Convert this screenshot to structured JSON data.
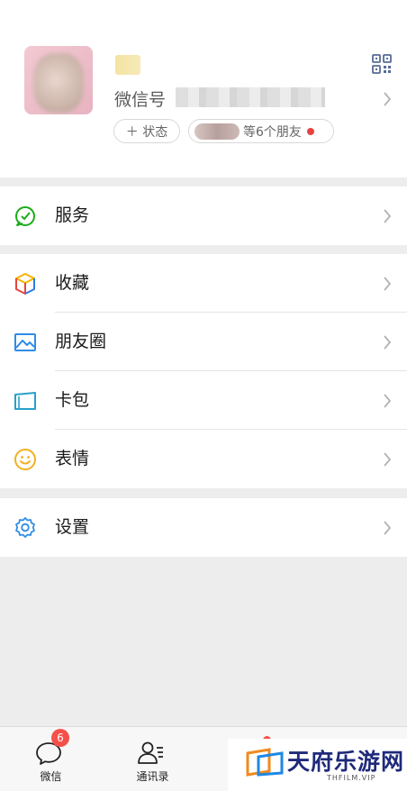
{
  "profile": {
    "wechat_id_label": "微信号",
    "status_button": "＋ 状态",
    "friends_text": "等6个朋友"
  },
  "menu": {
    "services": "服务",
    "favorites": "收藏",
    "moments": "朋友圈",
    "cards": "卡包",
    "stickers": "表情",
    "settings": "设置"
  },
  "tabbar": {
    "chats_label": "微信",
    "chats_badge": "6",
    "contacts_label": "通讯录"
  },
  "watermark": {
    "title": "天府乐游网",
    "subtitle": "THFILM.VIP"
  },
  "colors": {
    "green": "#07c160",
    "badge_red": "#f5504a",
    "background": "#ededed"
  }
}
